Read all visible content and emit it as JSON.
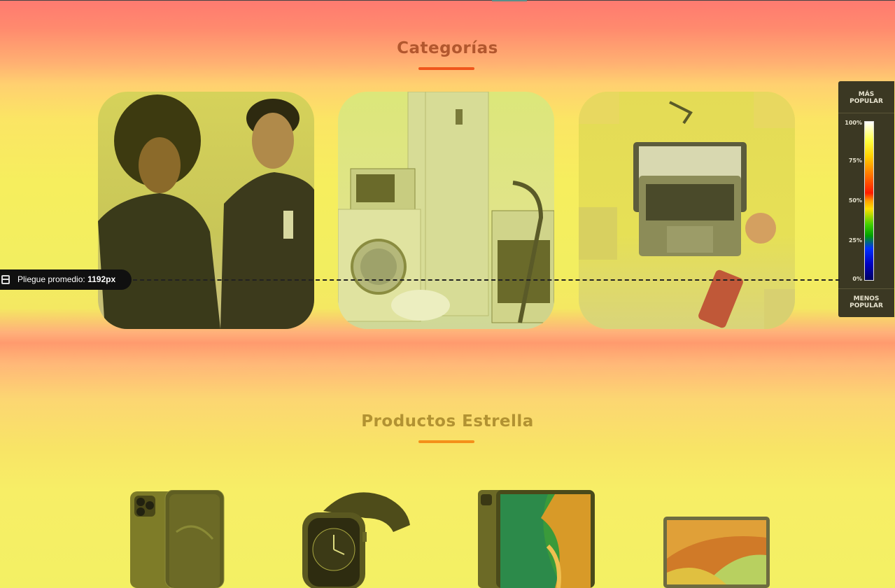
{
  "categories": {
    "title": "Categorías",
    "items": [
      {
        "name": "fashion-category-image"
      },
      {
        "name": "appliances-category-image"
      },
      {
        "name": "electronics-category-image"
      }
    ]
  },
  "featured": {
    "title": "Productos Estrella",
    "products": [
      {
        "name": "iphone-product-image"
      },
      {
        "name": "smartwatch-product-image"
      },
      {
        "name": "ipad-product-image"
      },
      {
        "name": "macbook-product-image"
      }
    ]
  },
  "heatmap_legend": {
    "top_label_1": "MÁS",
    "top_label_2": "POPULAR",
    "bottom_label_1": "MENOS",
    "bottom_label_2": "POPULAR",
    "ticks": [
      "100%",
      "75%",
      "50%",
      "25%",
      "0%"
    ]
  },
  "fold": {
    "label": "Pliegue promedio:",
    "value": "1192px"
  },
  "colors": {
    "accent_red": "#f0561c",
    "accent_orange": "#f4901a"
  }
}
